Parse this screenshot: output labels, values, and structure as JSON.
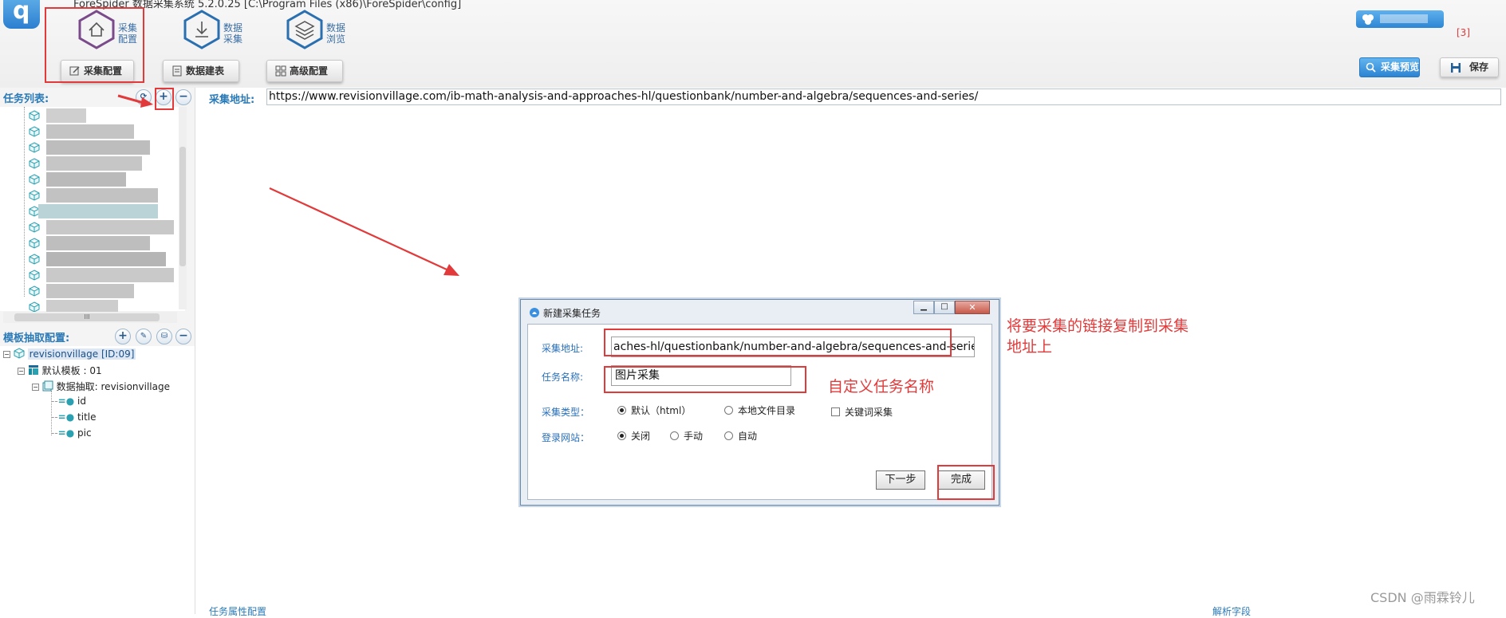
{
  "window": {
    "title": "ForeSpider 数据采集系统  5.2.0.25   [C:\\Program Files (x86)\\ForeSpider\\config]"
  },
  "ribbon": {
    "main_buttons": [
      {
        "label": "采集\n配置",
        "icon": "home-icon"
      },
      {
        "label": "数据\n采集",
        "icon": "download-icon"
      },
      {
        "label": "数据\n浏览",
        "icon": "layers-icon"
      }
    ],
    "sub_buttons": [
      {
        "label": "采集配置",
        "icon": "edit-icon"
      },
      {
        "label": "数据建表",
        "icon": "document-icon"
      },
      {
        "label": "高级配置",
        "icon": "grid-icon"
      }
    ],
    "preview_label": "采集预览",
    "save_label": "保存",
    "badge": "[3]"
  },
  "left_panel": {
    "task_list_title": "任务列表:",
    "template_title": "模板抽取配置:",
    "template_tree": [
      {
        "label": "revisionvillage [ID:09]",
        "level": 0
      },
      {
        "label": "默认模板 : 01",
        "level": 1
      },
      {
        "label": "数据抽取: revisionvillage",
        "level": 2
      },
      {
        "label": "id",
        "level": 3
      },
      {
        "label": "title",
        "level": 3
      },
      {
        "label": "pic",
        "level": 3
      }
    ],
    "scroll_grip": "III"
  },
  "main": {
    "url_label": "采集地址:",
    "url_value": "https://www.revisionvillage.com/ib-math-analysis-and-approaches-hl/questionbank/number-and-algebra/sequences-and-series/"
  },
  "dialog": {
    "title": "新建采集任务",
    "url_label": "采集地址:",
    "url_value": "aches-hl/questionbank/number-and-algebra/sequences-and-series/",
    "name_label": "任务名称:",
    "name_value": "图片采集",
    "type_label": "采集类型：",
    "type_options": [
      "默认（html）",
      "本地文件目录"
    ],
    "keyword_label": "关键词采集",
    "login_label": "登录网站：",
    "login_options": [
      "关闭",
      "手动",
      "自动"
    ],
    "next_label": "下一步",
    "finish_label": "完成"
  },
  "annotations": {
    "note_url": "将要采集的链接复制到采集\n地址上",
    "note_name": "自定义任务名称",
    "color": "#e23a3a"
  },
  "footer": {
    "watermark": "CSDN @雨霖铃儿",
    "left": "任务属性配置",
    "right": "解析字段"
  }
}
